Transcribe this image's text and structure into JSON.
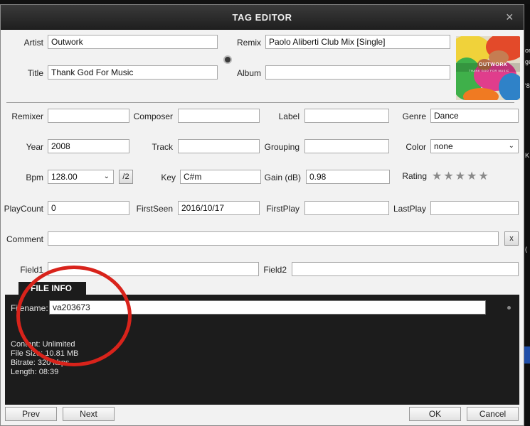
{
  "dialog": {
    "title": "TAG EDITOR",
    "close_glyph": "×"
  },
  "fields": {
    "artist": {
      "label": "Artist",
      "value": "Outwork"
    },
    "remix": {
      "label": "Remix",
      "value": "Paolo Aliberti Club Mix [Single]"
    },
    "title": {
      "label": "Title",
      "value": "Thank God For Music"
    },
    "album": {
      "label": "Album",
      "value": ""
    },
    "remixer": {
      "label": "Remixer",
      "value": ""
    },
    "composer": {
      "label": "Composer",
      "value": ""
    },
    "label": {
      "label": "Label",
      "value": ""
    },
    "genre": {
      "label": "Genre",
      "value": "Dance"
    },
    "year": {
      "label": "Year",
      "value": "2008"
    },
    "track": {
      "label": "Track",
      "value": ""
    },
    "grouping": {
      "label": "Grouping",
      "value": ""
    },
    "color": {
      "label": "Color",
      "value": "none"
    },
    "bpm": {
      "label": "Bpm",
      "value": "128.00",
      "half_button": "/2"
    },
    "key": {
      "label": "Key",
      "value": "C#m"
    },
    "gain": {
      "label": "Gain (dB)",
      "value": "0.98"
    },
    "rating": {
      "label": "Rating",
      "stars": "★★★★★",
      "value": 0
    },
    "playcount": {
      "label": "PlayCount",
      "value": "0"
    },
    "firstseen": {
      "label": "FirstSeen",
      "value": "2016/10/17"
    },
    "firstplay": {
      "label": "FirstPlay",
      "value": ""
    },
    "lastplay": {
      "label": "LastPlay",
      "value": ""
    },
    "comment": {
      "label": "Comment",
      "value": "",
      "clear_button": "x"
    },
    "field1": {
      "label": "Field1",
      "value": ""
    },
    "field2": {
      "label": "Field2",
      "value": ""
    }
  },
  "album_art": {
    "text_top": "OUTWORK",
    "text_sub": "THANK GOD FOR MUSIC"
  },
  "file_info": {
    "tab_label": "FILE INFO",
    "filename_label": "Filename:",
    "filename_value": "va203673",
    "content": "Content: Unlimited",
    "file_size": "File Size: 10.81 MB",
    "bitrate": "Bitrate: 320 kbps",
    "length": "Length: 08:39"
  },
  "footer": {
    "prev": "Prev",
    "next": "Next",
    "ok": "OK",
    "cancel": "Cancel"
  },
  "background_fragments": [
    "or",
    "ge",
    "'8",
    "K",
    "("
  ],
  "colors": {
    "title_bar": "#2b2b2b",
    "panel_dark": "#1c1c1c",
    "annotation_ring": "#d8231b"
  }
}
